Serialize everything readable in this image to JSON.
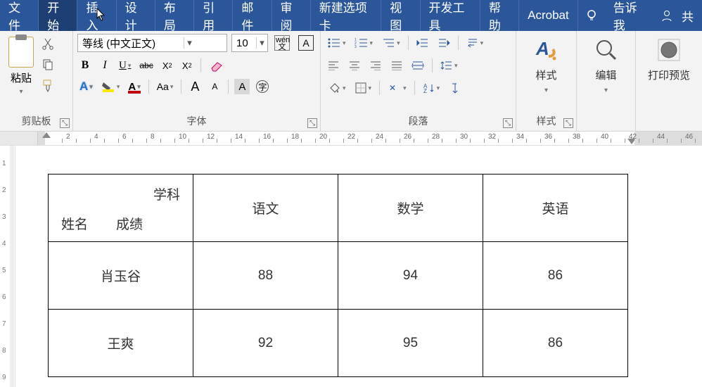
{
  "tabs": {
    "file": "文件",
    "home": "开始",
    "insert": "插入",
    "design": "设计",
    "layout": "布局",
    "references": "引用",
    "mailings": "邮件",
    "review": "审阅",
    "newtab": "新建选项卡",
    "view": "视图",
    "developer": "开发工具",
    "help": "帮助",
    "acrobat": "Acrobat",
    "tellme": "告诉我",
    "share": "共"
  },
  "clipboard": {
    "paste": "粘贴",
    "group": "剪贴板"
  },
  "font": {
    "name": "等线 (中文正文)",
    "size": "10",
    "group": "字体",
    "bold": "B",
    "italic": "I",
    "underline": "U",
    "strike": "abc",
    "sub": "X",
    "sup": "X",
    "bigA": "A",
    "smallA": "A",
    "aa": "Aa",
    "wen_top": "wén",
    "wen_bot": "文"
  },
  "paragraph": {
    "group": "段落"
  },
  "styles": {
    "label": "样式",
    "group": "样式"
  },
  "editing": {
    "label": "编辑"
  },
  "preview": {
    "label": "打印预览"
  },
  "ruler": {
    "marks": [
      "2",
      "4",
      "6",
      "8",
      "10",
      "12",
      "14",
      "16",
      "18",
      "20",
      "22",
      "24",
      "26",
      "28",
      "30",
      "32",
      "34",
      "36",
      "38",
      "40",
      "42",
      "44",
      "46"
    ]
  },
  "vruler": {
    "marks": [
      "1",
      "2",
      "3",
      "4",
      "5",
      "6",
      "7",
      "8",
      "9"
    ]
  },
  "chart_data": {
    "type": "table",
    "corner": {
      "top": "学科",
      "left": "姓名",
      "mid": "成绩"
    },
    "columns": [
      "语文",
      "数学",
      "英语"
    ],
    "rows": [
      {
        "name": "肖玉谷",
        "values": [
          88,
          94,
          86
        ]
      },
      {
        "name": "王爽",
        "values": [
          92,
          95,
          86
        ]
      }
    ]
  }
}
